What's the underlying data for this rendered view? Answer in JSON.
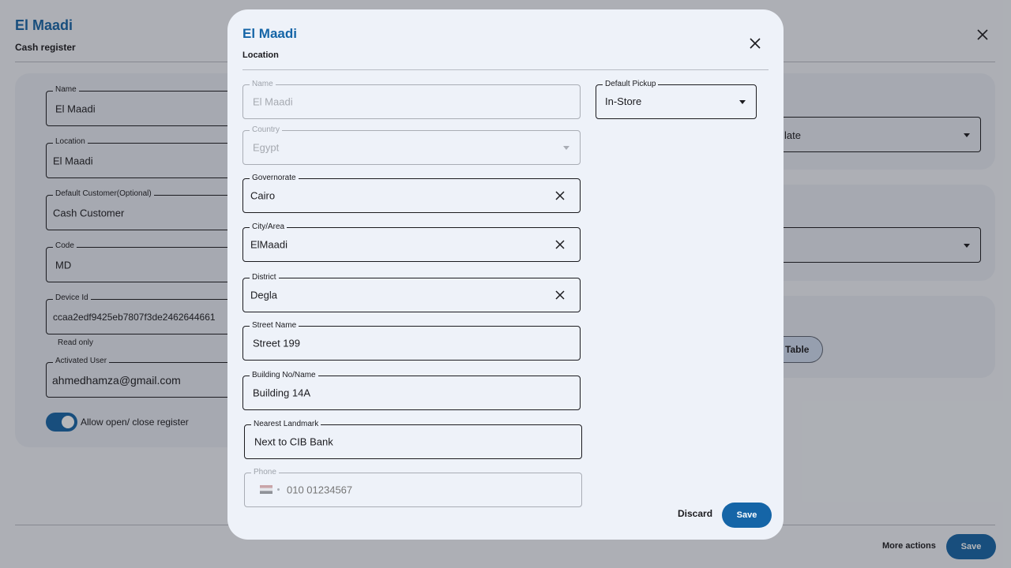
{
  "background": {
    "title": "El Maadi",
    "subtitle": "Cash register",
    "fields": {
      "name": {
        "label": "Name",
        "value": "El Maadi"
      },
      "location": {
        "label": "Location",
        "value": "El Maadi"
      },
      "default_customer": {
        "label": "Default Customer(Optional)",
        "value": "Cash Customer"
      },
      "code": {
        "label": "Code",
        "value": "MD"
      },
      "device_id": {
        "label": "Device Id",
        "value": "ccaa2edf9425eb7807f3de2462644661",
        "helper": "Read only"
      },
      "activated_user": {
        "label": "Activated User",
        "value": "ahmedhamza@gmail.com"
      }
    },
    "toggle_label": "Allow open/ close register",
    "toggle_on": true,
    "right_select_value": "late",
    "table_chip_label": "Table",
    "more_actions_label": "More actions",
    "save_label": "Save"
  },
  "dialog": {
    "title": "El Maadi",
    "subtitle": "Location",
    "fields": {
      "name": {
        "label": "Name",
        "value": "El Maadi"
      },
      "country": {
        "label": "Country",
        "value": "Egypt"
      },
      "governorate": {
        "label": "Governorate",
        "value": "Cairo"
      },
      "city": {
        "label": "City/Area",
        "value": "ElMaadi"
      },
      "district": {
        "label": "District",
        "value": "Degla"
      },
      "street": {
        "label": "Street Name",
        "value": "Street 199"
      },
      "building": {
        "label": "Building No/Name",
        "value": "Building 14A"
      },
      "landmark": {
        "label": "Nearest Landmark",
        "value": "Next to CIB Bank"
      },
      "phone": {
        "label": "Phone",
        "placeholder": "010 01234567"
      },
      "default_pickup": {
        "label": "Default Pickup",
        "value": "In-Store"
      }
    },
    "discard_label": "Discard",
    "save_label": "Save"
  },
  "colors": {
    "accent": "#1565a7",
    "surface": "#eef2f9"
  }
}
